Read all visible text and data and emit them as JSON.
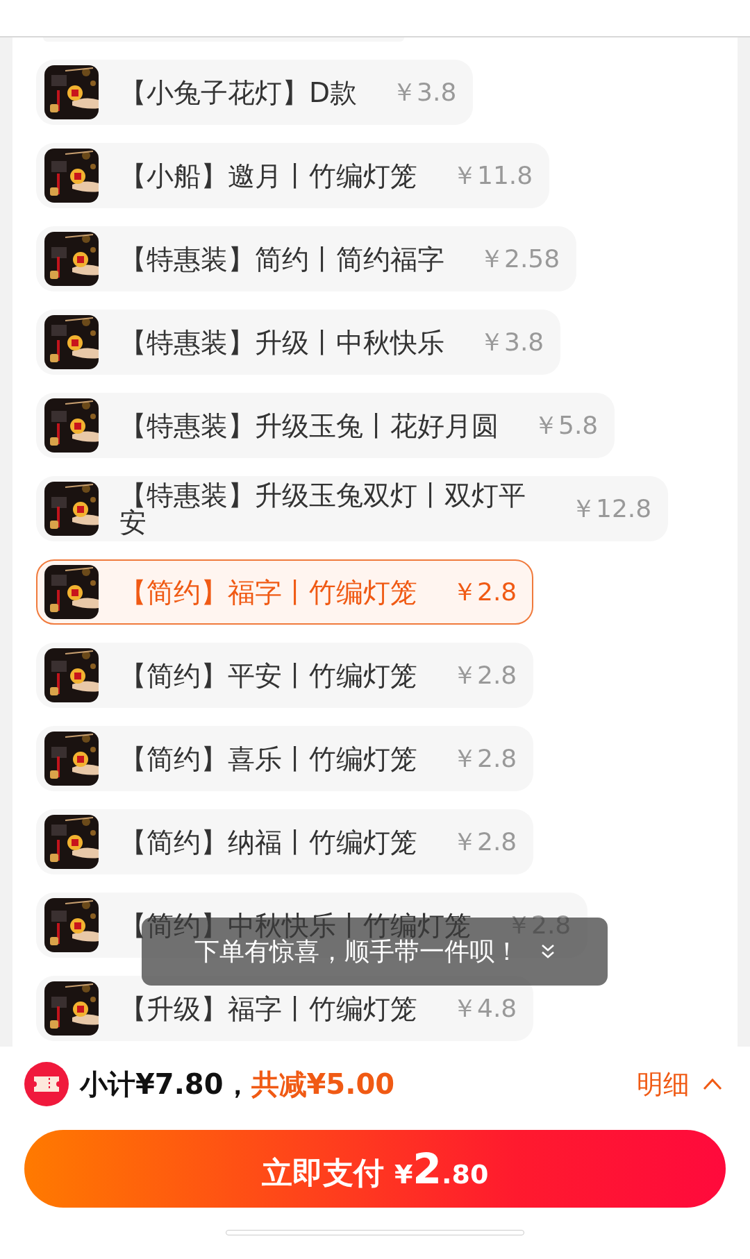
{
  "items": [
    {
      "title": "【小兔子花灯】D款",
      "price": "￥3.8",
      "selected": false
    },
    {
      "title": "【小船】邀月丨竹编灯笼",
      "price": "￥11.8",
      "selected": false
    },
    {
      "title": "【特惠装】简约丨简约福字",
      "price": "￥2.58",
      "selected": false
    },
    {
      "title": "【特惠装】升级丨中秋快乐",
      "price": "￥3.8",
      "selected": false
    },
    {
      "title": "【特惠装】升级玉兔丨花好月圆",
      "price": "￥5.8",
      "selected": false
    },
    {
      "title": "【特惠装】升级玉兔双灯丨双灯平安",
      "price": "￥12.8",
      "selected": false
    },
    {
      "title": "【简约】福字丨竹编灯笼",
      "price": "￥2.8",
      "selected": true
    },
    {
      "title": "【简约】平安丨竹编灯笼",
      "price": "￥2.8",
      "selected": false
    },
    {
      "title": "【简约】喜乐丨竹编灯笼",
      "price": "￥2.8",
      "selected": false
    },
    {
      "title": "【简约】纳福丨竹编灯笼",
      "price": "￥2.8",
      "selected": false
    },
    {
      "title": "【简约】中秋快乐丨竹编灯笼",
      "price": "￥2.8",
      "selected": false
    },
    {
      "title": "【升级】福字丨竹编灯笼",
      "price": "￥4.8",
      "selected": false
    }
  ],
  "toast": {
    "text": "下单有惊喜，顺手带一件呗！"
  },
  "summary": {
    "subtotal": "小计¥7.80，",
    "discount": "共减¥5.00",
    "details_link": "明细"
  },
  "pay_button": {
    "label": "立即支付",
    "currency": "¥",
    "amount_int": "2",
    "amount_dec": ".80"
  }
}
